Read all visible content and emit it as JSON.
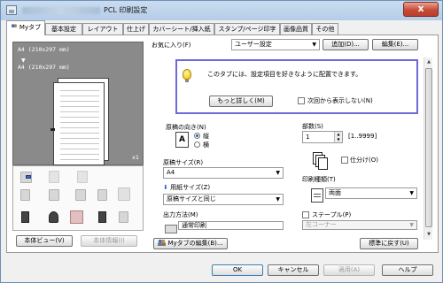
{
  "window": {
    "title": "PCL 印刷設定",
    "close_label": "x"
  },
  "tabs": [
    {
      "label": "Myタブ",
      "active": true
    },
    {
      "label": "基本設定"
    },
    {
      "label": "レイアウト"
    },
    {
      "label": "仕上げ"
    },
    {
      "label": "カバーシート/挿入紙"
    },
    {
      "label": "スタンプ/ページ印字"
    },
    {
      "label": "画像品質"
    },
    {
      "label": "その他"
    }
  ],
  "preview": {
    "source_size": "A4 (210x297 mm)",
    "arrow": "▼",
    "output_size": "A4 (210x297 mm)",
    "quantity": "x1"
  },
  "left_buttons": {
    "view": "本体ビュー(V)",
    "info": "本体情報(I)"
  },
  "favorites": {
    "label": "お気に入り(F)",
    "value": "ユーザー設定",
    "add": "追加(D)...",
    "edit": "編集(E)..."
  },
  "info_box": {
    "message": "このタブには、設定項目を好きなように配置できます。",
    "more_button": "もっと詳しく(M)",
    "hide_checkbox": "次回から表示しない(N)"
  },
  "orientation": {
    "label": "原稿の向き(N)",
    "icon_letter": "A",
    "portrait": "縦",
    "landscape": "横",
    "selected": "portrait"
  },
  "original_size": {
    "label": "原稿サイズ(R)",
    "value": "A4"
  },
  "paper_size": {
    "label": "用紙サイズ(Z)",
    "value": "原稿サイズと同じ"
  },
  "output_method": {
    "label": "出力方法(M)",
    "value": "通常印刷"
  },
  "copies": {
    "label": "部数(S)",
    "value": "1",
    "range": "[1..9999]",
    "collate": "仕分け(O)"
  },
  "print_type": {
    "label": "印刷種類(T)",
    "value": "両面"
  },
  "staple": {
    "label": "ステープル(P)",
    "value": "左コーナー"
  },
  "mytab_edit": "Myタブの編集(B)...",
  "restore_default": "標準に戻す(U)",
  "dialog": {
    "ok": "OK",
    "cancel": "キャンセル",
    "apply": "適用(A)",
    "help": "ヘルプ"
  },
  "colors": {
    "info_border": "#6b6bd6",
    "preview_bg": "#8a8a8a",
    "close_red": "#c74a36"
  }
}
